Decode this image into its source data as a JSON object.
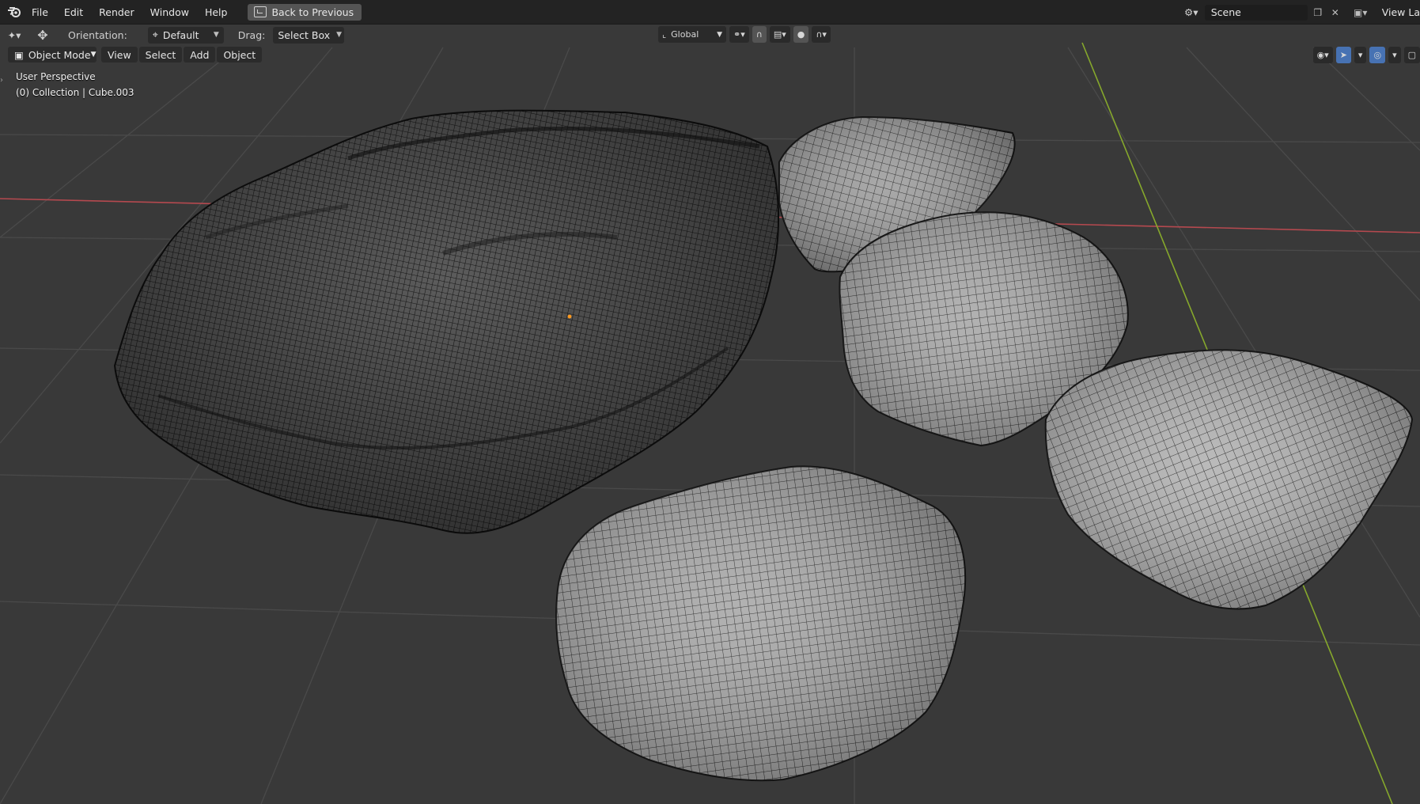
{
  "menubar": {
    "items": [
      "File",
      "Edit",
      "Render",
      "Window",
      "Help"
    ],
    "back_label": "Back to Previous",
    "scene_label": "Scene",
    "view_layer_label": "View La"
  },
  "toolheader": {
    "orientation_label": "Orientation:",
    "orientation_value": "Default",
    "drag_label": "Drag:",
    "drag_value": "Select Box",
    "transform_space": "Global"
  },
  "viewport_header": {
    "mode": "Object Mode",
    "menus": [
      "View",
      "Select",
      "Add",
      "Object"
    ]
  },
  "overlay": {
    "perspective": "User Perspective",
    "collection": "(0) Collection | Cube.003"
  },
  "colors": {
    "background": "#393939",
    "topbar": "#232323",
    "x_axis": "#b5494f",
    "y_axis": "#86a82c",
    "active_blue": "#4772b3"
  },
  "icons": {
    "app": "blender-logo-icon",
    "back": "back-to-previous-icon",
    "scene": "scene-icon",
    "move": "move-tool-icon",
    "snap": "magnet-icon",
    "proportional": "proportional-edit-icon",
    "visibility": "eye-icon",
    "gizmo": "gizmo-icon",
    "overlay": "overlays-icon"
  }
}
